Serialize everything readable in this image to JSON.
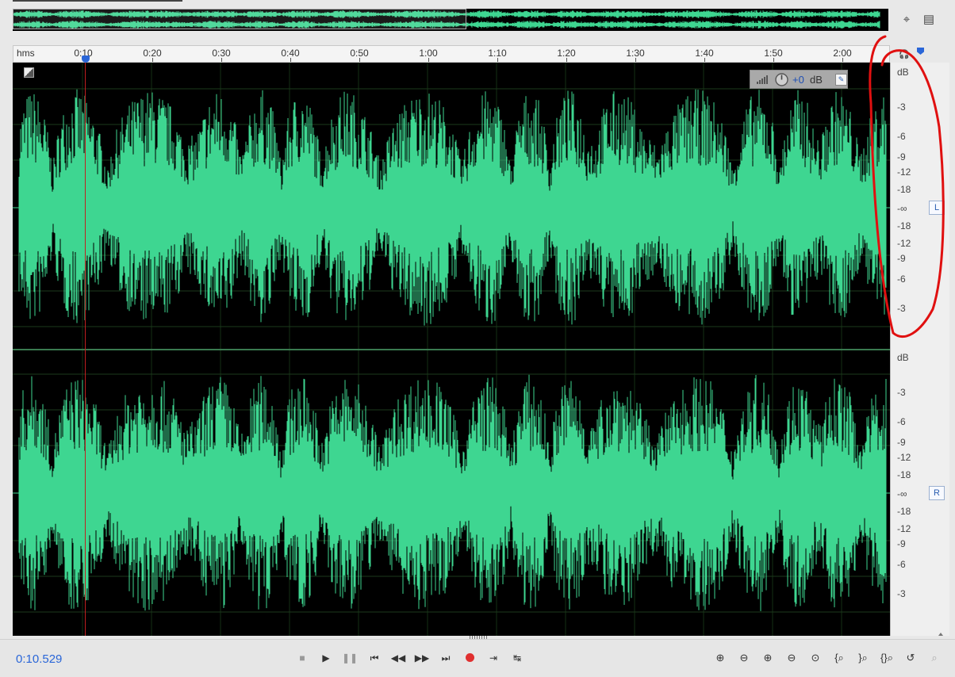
{
  "ruler": {
    "unit_label": "hms",
    "ticks": [
      "0:10",
      "0:20",
      "0:30",
      "0:40",
      "0:50",
      "1:00",
      "1:10",
      "1:20",
      "1:30",
      "1:40",
      "1:50",
      "2:00"
    ]
  },
  "scale": {
    "title": "dB",
    "labels": [
      "-3",
      "-6",
      "-9",
      "-12",
      "-18",
      "-∞",
      "-18",
      "-12",
      "-9",
      "-6",
      "-3"
    ],
    "left_channel": "L",
    "right_channel": "R"
  },
  "hud": {
    "value": "+0",
    "unit": "dB"
  },
  "status": {
    "current_time": "0:10.529"
  },
  "colors": {
    "waveform": "#3ed691",
    "playhead": "#c02020",
    "time_text": "#2a66d8",
    "record": "#e03030",
    "annotation": "#e01010"
  },
  "icons": {
    "overview_zoom": "zoom-navigator-icon",
    "panel_menu": "panel-menu-icon",
    "headphones": "headphones-icon",
    "marker": "marker-icon"
  }
}
